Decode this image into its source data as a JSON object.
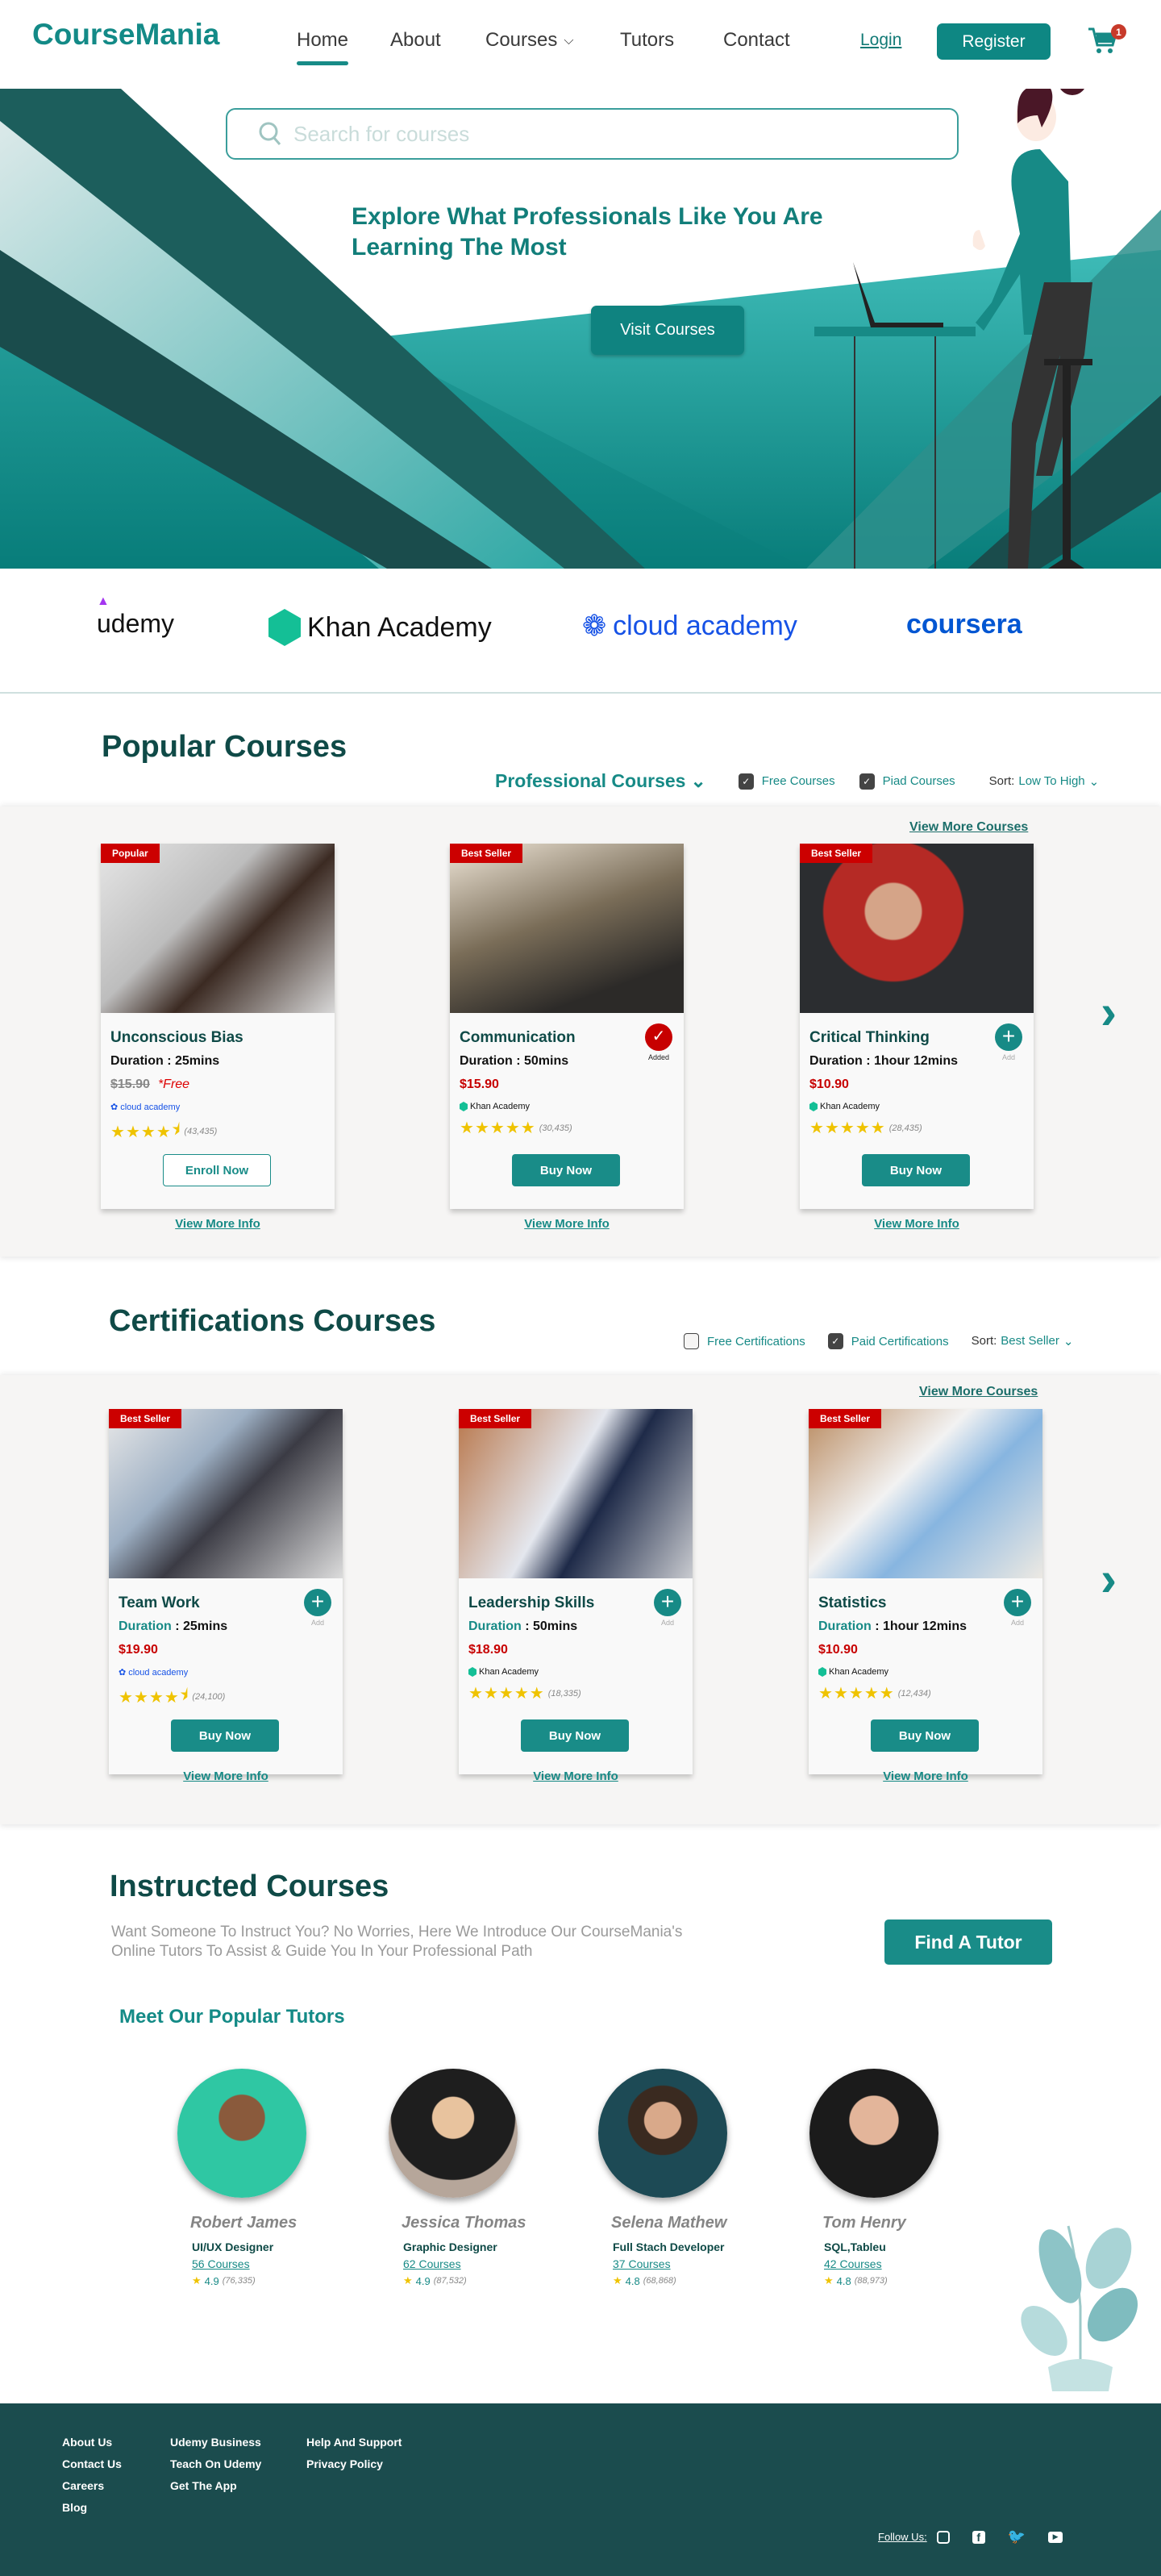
{
  "brand": "CourseMania",
  "nav": [
    {
      "label": "Home"
    },
    {
      "label": "About"
    },
    {
      "label": "Courses"
    },
    {
      "label": "Tutors"
    },
    {
      "label": "Contact"
    }
  ],
  "header": {
    "login": "Login",
    "register": "Register",
    "cart_count": "1"
  },
  "search": {
    "placeholder": "Search for courses"
  },
  "hero": {
    "title_line1": "Explore What Professionals Like You Are",
    "title_line2": "Learning The Most",
    "cta": "Visit Courses"
  },
  "partners": [
    "udemy",
    "Khan Academy",
    "cloud academy",
    "coursera"
  ],
  "popular": {
    "title": "Popular Courses",
    "category": "Professional Courses",
    "free_label": "Free Courses",
    "paid_label": "Piad Courses",
    "free_checked": true,
    "paid_checked": true,
    "sort_label": "Sort:",
    "sort_value": "Low To High",
    "view_more": "View More Courses",
    "courses": [
      {
        "tag": "Popular",
        "title": "Unconscious Bias",
        "duration_label": "Duration",
        "duration": "25mins",
        "old_price": "$15.90",
        "price": "*Free",
        "provider": "cloud academy",
        "stars": 4.5,
        "count": "(43,435)",
        "button": "Enroll Now",
        "button_style": "outline",
        "state": "none",
        "more": "View More Info"
      },
      {
        "tag": "Best Seller",
        "title": "Communication",
        "duration_label": "Duration",
        "duration": "50mins",
        "price": "$15.90",
        "provider": "Khan Academy",
        "stars": 5,
        "count": "(30,435)",
        "button": "Buy Now",
        "state": "added",
        "state_label": "Added",
        "more": "View More Info"
      },
      {
        "tag": "Best Seller",
        "title": "Critical Thinking",
        "duration_label": "Duration",
        "duration": "1hour 12mins",
        "price": "$10.90",
        "provider": "Khan Academy",
        "stars": 5,
        "count": "(28,435)",
        "button": "Buy Now",
        "state": "add",
        "state_label": "Add",
        "more": "View More Info"
      }
    ]
  },
  "certifications": {
    "title": "Certifications Courses",
    "free_label": "Free Certifications",
    "paid_label": "Paid Certifications",
    "free_checked": false,
    "paid_checked": true,
    "sort_label": "Sort:",
    "sort_value": "Best Seller",
    "view_more": "View More Courses",
    "courses": [
      {
        "tag": "Best Seller",
        "title": "Team Work",
        "duration_label": "Duration",
        "duration": "25mins",
        "price": "$19.90",
        "provider": "cloud academy",
        "stars": 4.5,
        "count": "(24,100)",
        "button": "Buy Now",
        "state": "add",
        "state_label": "Add",
        "more": "View More Info"
      },
      {
        "tag": "Best Seller",
        "title": "Leadership Skills",
        "duration_label": "Duration",
        "duration": "50mins",
        "price": "$18.90",
        "provider": "Khan Academy",
        "stars": 5,
        "count": "(18,335)",
        "button": "Buy Now",
        "state": "add",
        "state_label": "Add",
        "more": "View More Info"
      },
      {
        "tag": "Best Seller",
        "title": "Statistics",
        "duration_label": "Duration",
        "duration": "1hour 12mins",
        "price": "$10.90",
        "provider": "Khan Academy",
        "stars": 5,
        "count": "(12,434)",
        "button": "Buy Now",
        "state": "add",
        "state_label": "Add",
        "more": "View More Info"
      }
    ]
  },
  "instructed": {
    "title": "Instructed Courses",
    "text_line1": "Want Someone To Instruct You? No Worries, Here We Introduce Our CourseMania's",
    "text_line2": "Online Tutors  To Assist & Guide You In Your Professional  Path",
    "cta": "Find A Tutor",
    "subtitle": "Meet Our Popular Tutors"
  },
  "tutors": [
    {
      "name": "Robert James",
      "role": "UI/UX Designer",
      "courses": "56 Courses",
      "rating": "4.9",
      "count": "(76,335)"
    },
    {
      "name": "Jessica Thomas",
      "role": "Graphic Designer",
      "courses": "62 Courses",
      "rating": "4.9",
      "count": "(87,532)"
    },
    {
      "name": "Selena Mathew",
      "role": "Full Stach Developer",
      "courses": "37 Courses",
      "rating": "4.8",
      "count": "(68,868)"
    },
    {
      "name": "Tom  Henry",
      "role": "SQL,Tableu",
      "courses": "42 Courses",
      "rating": "4.8",
      "count": "(88,973)"
    }
  ],
  "footer": {
    "col1": [
      "About Us",
      "Contact Us",
      "Careers",
      "Blog"
    ],
    "col2": [
      "Udemy Business",
      "Teach On Udemy",
      "Get The App"
    ],
    "col3": [
      "Help And Support",
      "Privacy Policy"
    ],
    "follow": "Follow Us:"
  },
  "colors": {
    "primary": "#178a86",
    "dark": "#0f4a47",
    "footer": "#1b4c4e",
    "sale": "#cc0000",
    "star": "#efc300"
  }
}
